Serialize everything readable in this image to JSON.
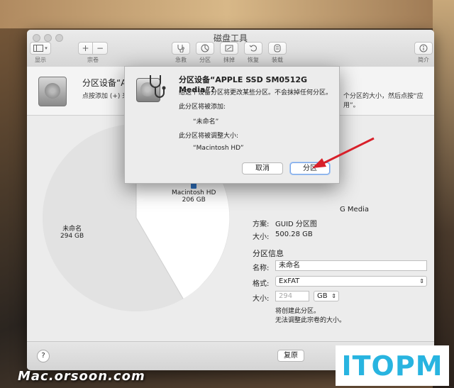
{
  "window": {
    "title": "磁盘工具",
    "toolbar": [
      {
        "label": "显示",
        "icon": "sidebar-icon"
      },
      {
        "label": "宗卷",
        "icon": "add-remove-icon"
      },
      {
        "label": "急救",
        "icon": "stethoscope-icon"
      },
      {
        "label": "分区",
        "icon": "partition-icon"
      },
      {
        "label": "抹掉",
        "icon": "erase-icon"
      },
      {
        "label": "恢复",
        "icon": "restore-icon"
      },
      {
        "label": "装载",
        "icon": "mount-icon"
      },
      {
        "label": "简介",
        "icon": "info-icon"
      }
    ]
  },
  "info": {
    "title": "分区设备“APPLE SSD SM0512G Media”?",
    "desc_left": "点按添加 (+) 来增",
    "desc_right": "个分区的大小，然后点按“应用”。"
  },
  "pie": {
    "slice_unnamed": {
      "name": "未命名",
      "size": "294 GB"
    },
    "slice_mac": {
      "name": "Macintosh HD",
      "size": "206 GB"
    }
  },
  "device": {
    "name_suffix": "G Media",
    "scheme_label": "方案:",
    "scheme_value": "GUID 分区图",
    "size_label": "大小:",
    "size_value": "500.28 GB"
  },
  "partition_info": {
    "header": "分区信息",
    "name_label": "名称:",
    "name_value": "未命名",
    "format_label": "格式:",
    "format_value": "ExFAT",
    "size_label": "大小:",
    "size_placeholder": "294",
    "size_unit": "GB",
    "note_line1": "将创建此分区。",
    "note_line2": "无法调整此宗卷的大小。"
  },
  "bottom": {
    "help": "?",
    "revert": "复原"
  },
  "dialog": {
    "title": "分区设备“APPLE SSD SM0512G Media”?",
    "subtitle": "给这个设备分区将更改某些分区。不会抹掉任何分区。",
    "added_label": "此分区将被添加:",
    "added_name": "“未命名”",
    "resized_label": "此分区将被调整大小:",
    "resized_name": "“Macintosh HD”",
    "cancel": "取消",
    "confirm": "分区"
  },
  "watermark": "Mac.orsoon.com",
  "logo_text": "ITOPM",
  "colors": {
    "arrow": "#d8202a",
    "logo": "#28b4e0"
  }
}
